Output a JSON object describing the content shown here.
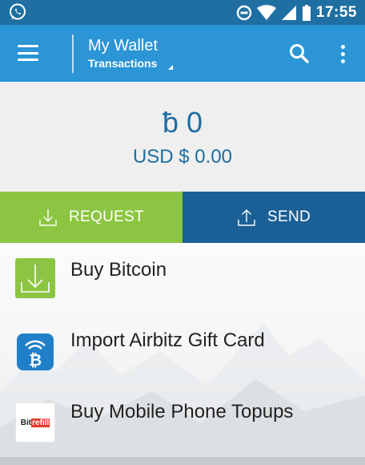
{
  "status_bar": {
    "time": "17:55",
    "icons": [
      "whatsapp-icon",
      "do-not-disturb-icon",
      "wifi-icon",
      "cell-signal-icon",
      "battery-icon"
    ]
  },
  "app_bar": {
    "title": "My Wallet",
    "subtitle": "Transactions",
    "icons": [
      "menu-icon",
      "search-icon",
      "more-vert-icon"
    ]
  },
  "balance": {
    "bitcoin": "ƀ 0",
    "fiat": "USD $ 0.00"
  },
  "actions": {
    "request_label": "REQUEST",
    "send_label": "SEND"
  },
  "list": {
    "items": [
      {
        "label": "Buy Bitcoin",
        "icon": "download-icon"
      },
      {
        "label": "Import Airbitz Gift Card",
        "icon": "bitcoin-card-icon"
      },
      {
        "label": "Buy Mobile Phone Topups",
        "icon": "bitrefill-logo",
        "logo_text_1": "Bit",
        "logo_text_2": "refill"
      }
    ]
  },
  "colors": {
    "status_bar": "#1f6fa3",
    "app_bar": "#2b95d6",
    "balance_text": "#1d6ea2",
    "request": "#8cc541",
    "send": "#1a5f95"
  }
}
